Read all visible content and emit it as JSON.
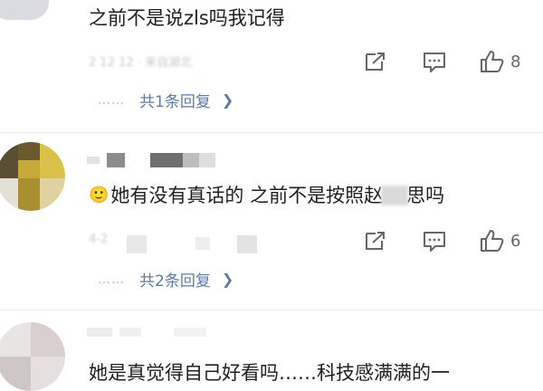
{
  "comments": [
    {
      "text": "之前不是说zls吗我记得",
      "meta_blurred": "2 12 12 · 来自湖北",
      "like_count": "8",
      "reply_label": "共1条回复",
      "reply_dots": "……"
    },
    {
      "emoji": "🙂",
      "text_before": "她有没有真话的 之前不是按照赵",
      "text_after": "思吗",
      "meta_blurred": "4-2",
      "like_count": "6",
      "reply_label": "共2条回复",
      "reply_dots": "……"
    },
    {
      "text": "她是真觉得自己好看吗……科技感满满的一"
    }
  ],
  "icons": {
    "share": "share-icon",
    "comment": "comment-icon",
    "like": "thumb-up-icon",
    "chevron": "chevron-right-icon"
  },
  "colors": {
    "link": "#5b7ca8",
    "text": "#1f1f1f",
    "muted": "#666666",
    "divider": "#ececec"
  }
}
